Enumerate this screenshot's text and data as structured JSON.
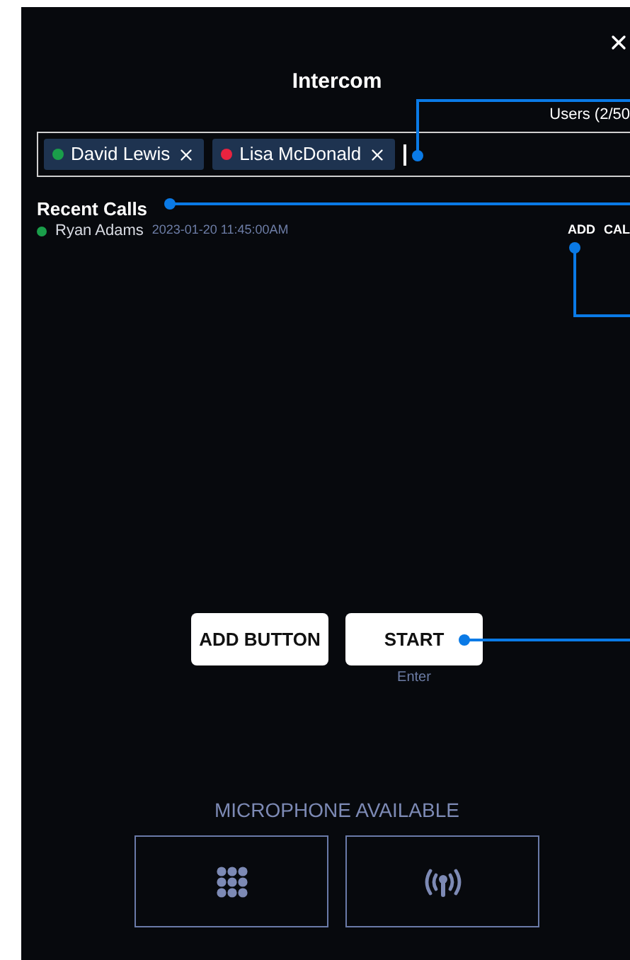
{
  "title": "Intercom",
  "users_count": "Users (2/50",
  "recipients": [
    {
      "name": "David Lewis",
      "color": "#1a9e4a"
    },
    {
      "name": "Lisa McDonald",
      "color": "#e8233f"
    }
  ],
  "recent_calls": {
    "heading": "Recent Calls",
    "items": [
      {
        "name": "Ryan Adams",
        "time": "2023-01-20 11:45:00AM",
        "color": "#1a9e4a",
        "actions": [
          "ADD",
          "CAL"
        ]
      }
    ]
  },
  "buttons": [
    {
      "label": "ADD BUTTON"
    },
    {
      "label": "START",
      "hint": "Enter"
    }
  ],
  "microphone_status": "MICROPHONE AVAILABLE"
}
